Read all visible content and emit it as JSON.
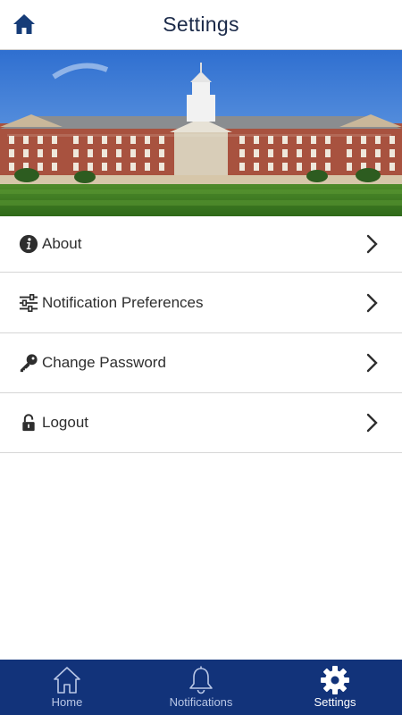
{
  "header": {
    "title": "Settings",
    "home_icon": "home-icon"
  },
  "hero": {
    "image": "campus-building-photo"
  },
  "menu": {
    "items": [
      {
        "label": "About",
        "icon": "info-icon"
      },
      {
        "label": "Notification Preferences",
        "icon": "sliders-icon"
      },
      {
        "label": "Change Password",
        "icon": "key-icon"
      },
      {
        "label": "Logout",
        "icon": "lock-icon"
      }
    ]
  },
  "tabbar": {
    "background": "#12337a",
    "tabs": [
      {
        "label": "Home",
        "icon": "home-outline-icon",
        "active": false
      },
      {
        "label": "Notifications",
        "icon": "bell-icon",
        "active": false
      },
      {
        "label": "Settings",
        "icon": "gear-icon",
        "active": true
      }
    ]
  }
}
